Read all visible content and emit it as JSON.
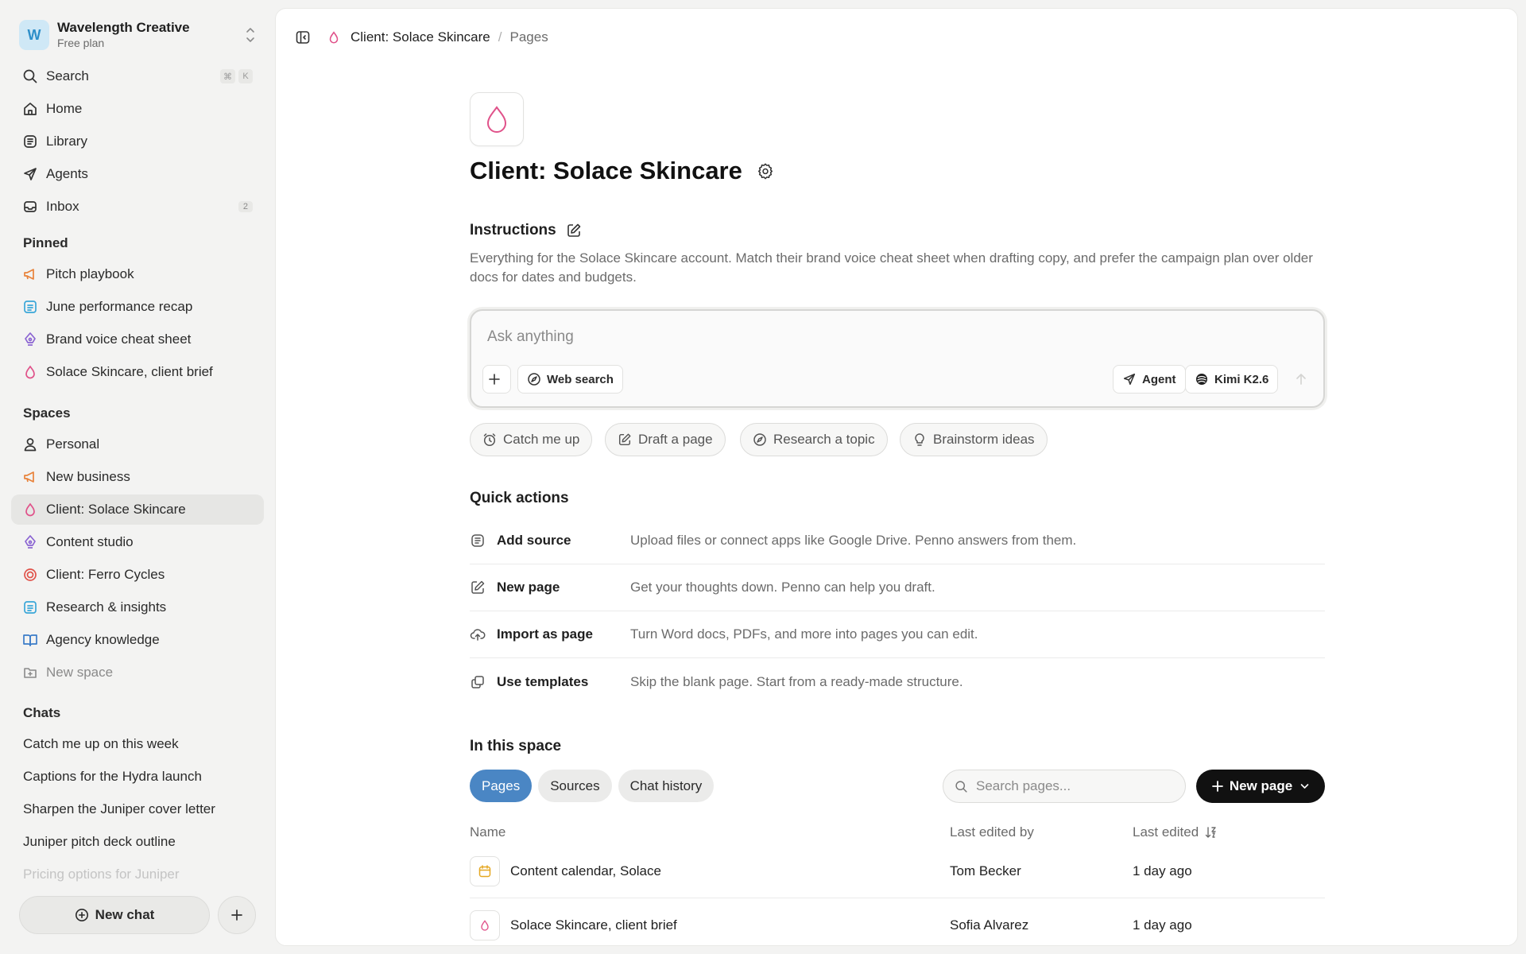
{
  "workspace": {
    "initial": "W",
    "name": "Wavelength Creative",
    "plan": "Free plan"
  },
  "nav": {
    "search_label": "Search",
    "search_shortcut": [
      "⌘",
      "K"
    ],
    "home_label": "Home",
    "library_label": "Library",
    "agents_label": "Agents",
    "inbox_label": "Inbox",
    "inbox_count": "2"
  },
  "pinned": {
    "title": "Pinned",
    "items": [
      {
        "label": "Pitch playbook",
        "icon": "megaphone-icon"
      },
      {
        "label": "June performance recap",
        "icon": "document-icon"
      },
      {
        "label": "Brand voice cheat sheet",
        "icon": "pen-nib-icon"
      },
      {
        "label": "Solace Skincare, client brief",
        "icon": "droplet-icon"
      }
    ]
  },
  "spaces": {
    "title": "Spaces",
    "items": [
      {
        "label": "Personal",
        "icon": "person-icon"
      },
      {
        "label": "New business",
        "icon": "megaphone-icon"
      },
      {
        "label": "Client: Solace Skincare",
        "icon": "droplet-icon",
        "active": true
      },
      {
        "label": "Content studio",
        "icon": "pen-nib-icon"
      },
      {
        "label": "Client: Ferro Cycles",
        "icon": "target-icon"
      },
      {
        "label": "Research & insights",
        "icon": "document-icon"
      },
      {
        "label": "Agency knowledge",
        "icon": "book-icon"
      }
    ],
    "new_space_label": "New space"
  },
  "chats": {
    "title": "Chats",
    "items": [
      "Catch me up on this week",
      "Captions for the Hydra launch",
      "Sharpen the Juniper cover letter",
      "Juniper pitch deck outline",
      "Pricing options for Juniper"
    ],
    "new_chat_label": "New chat"
  },
  "breadcrumb": {
    "current": "Client: Solace Skincare",
    "separator": "/",
    "last": "Pages"
  },
  "page": {
    "title": "Client: Solace Skincare",
    "instructions_title": "Instructions",
    "instructions_text": "Everything for the Solace Skincare account. Match their brand voice cheat sheet when drafting copy, and prefer the campaign plan over older docs for dates and budgets."
  },
  "composer": {
    "placeholder": "Ask anything",
    "web_search_label": "Web search",
    "agent_label": "Agent",
    "model_label": "Kimi K2.6"
  },
  "suggestions": [
    "Catch me up",
    "Draft a page",
    "Research a topic",
    "Brainstorm ideas"
  ],
  "quick_actions": {
    "title": "Quick actions",
    "items": [
      {
        "title": "Add source",
        "desc": "Upload files or connect apps like Google Drive. Penno answers from them.",
        "icon": "source-icon"
      },
      {
        "title": "New page",
        "desc": "Get your thoughts down. Penno can help you draft.",
        "icon": "edit-icon"
      },
      {
        "title": "Import as page",
        "desc": "Turn Word docs, PDFs, and more into pages you can edit.",
        "icon": "upload-cloud-icon"
      },
      {
        "title": "Use templates",
        "desc": "Skip the blank page. Start from a ready-made structure.",
        "icon": "template-icon"
      }
    ]
  },
  "in_space": {
    "title": "In this space",
    "tabs": [
      "Pages",
      "Sources",
      "Chat history"
    ],
    "active_tab": "Pages",
    "search_placeholder": "Search pages...",
    "new_page_label": "New page",
    "columns": [
      "Name",
      "Last edited by",
      "Last edited"
    ],
    "rows": [
      {
        "name": "Content calendar, Solace",
        "editor": "Tom Becker",
        "edited": "1 day ago",
        "icon": "calendar-icon"
      },
      {
        "name": "Solace Skincare, client brief",
        "editor": "Sofia Alvarez",
        "edited": "1 day ago",
        "icon": "droplet-icon"
      }
    ]
  },
  "colors": {
    "accent_blue": "#4a86c4",
    "droplet_pink": "#e0528a",
    "megaphone_orange": "#e8823a",
    "doc_blue": "#3aa6d8",
    "pen_purple": "#8a63d2",
    "target_red": "#e0524a"
  }
}
